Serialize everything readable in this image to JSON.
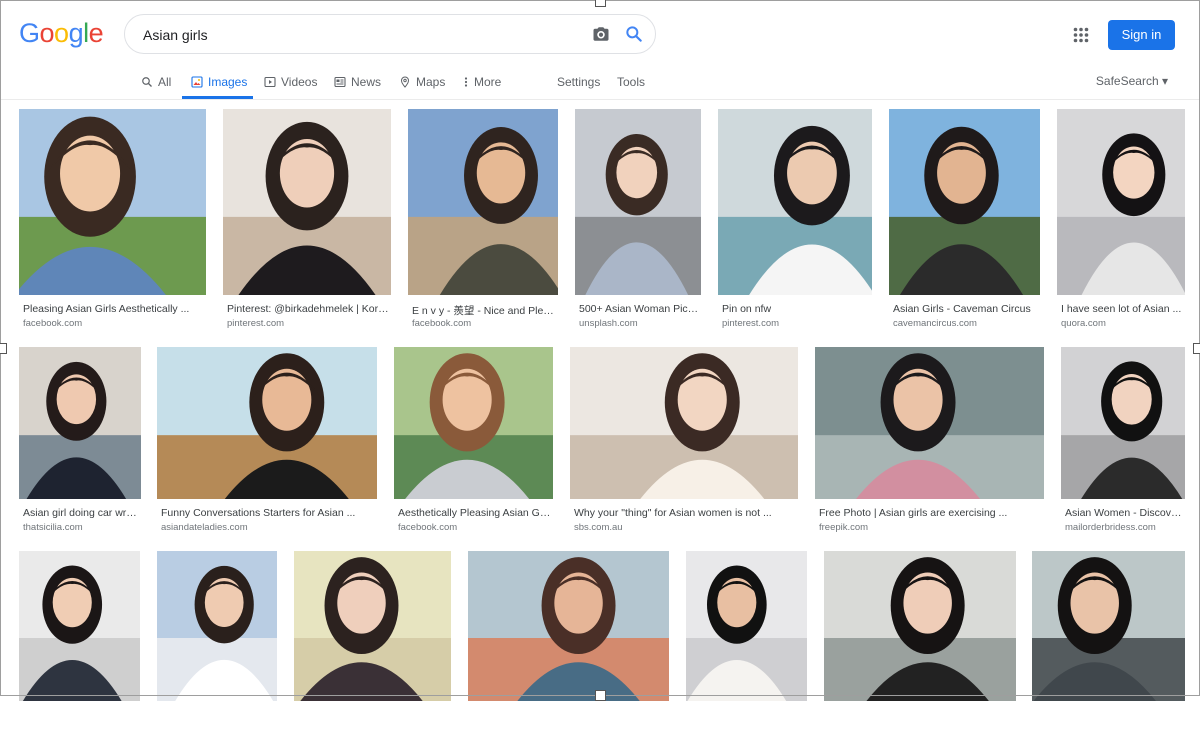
{
  "logo": {
    "letters": [
      "G",
      "o",
      "o",
      "g",
      "l",
      "e"
    ]
  },
  "search": {
    "query": "Asian girls"
  },
  "header": {
    "signin_label": "Sign in"
  },
  "tabs": [
    {
      "label": "All",
      "icon": "search-icon"
    },
    {
      "label": "Images",
      "icon": "image-icon",
      "active": true
    },
    {
      "label": "Videos",
      "icon": "video-icon"
    },
    {
      "label": "News",
      "icon": "news-icon"
    },
    {
      "label": "Maps",
      "icon": "map-pin-icon"
    },
    {
      "label": "More",
      "icon": "more-vertical-icon"
    },
    {
      "label": "Settings"
    },
    {
      "label": "Tools"
    }
  ],
  "safesearch_label": "SafeSearch",
  "colors": {
    "accent": "#1a73e8",
    "caption": "#3c4043",
    "domain": "#70757a"
  },
  "results": [
    {
      "caption": "Pleasing Asian Girls Aesthetically ...",
      "domain": "facebook.com"
    },
    {
      "caption": "Pinterest: @birkadehmelek | Kore...",
      "domain": "pinterest.com"
    },
    {
      "caption": "E n v y - 羨望 - Nice and Pleas...",
      "domain": "facebook.com"
    },
    {
      "caption": "500+ Asian Woman Pict...",
      "domain": "unsplash.com"
    },
    {
      "caption": "Pin on nfw",
      "domain": "pinterest.com"
    },
    {
      "caption": "Asian Girls - Caveman Circus",
      "domain": "cavemancircus.com"
    },
    {
      "caption": "I have seen lot of Asian ...",
      "domain": "quora.com"
    },
    {
      "caption": "Asian girl doing car wra...",
      "domain": "thatsicilia.com"
    },
    {
      "caption": "Funny Conversations Starters for Asian ...",
      "domain": "asiandateladies.com"
    },
    {
      "caption": "Aesthetically Pleasing Asian Gir...",
      "domain": "facebook.com"
    },
    {
      "caption": "Why your \"thing\" for Asian women is not ...",
      "domain": "sbs.com.au"
    },
    {
      "caption": "Free Photo | Asian girls are exercising ...",
      "domain": "freepik.com"
    },
    {
      "caption": "Asian Women - Discove...",
      "domain": "mailorderbridess.com"
    },
    {
      "caption": "",
      "domain": ""
    },
    {
      "caption": "",
      "domain": ""
    },
    {
      "caption": "",
      "domain": ""
    },
    {
      "caption": "",
      "domain": ""
    },
    {
      "caption": "",
      "domain": ""
    },
    {
      "caption": "",
      "domain": ""
    },
    {
      "caption": "",
      "domain": ""
    }
  ]
}
